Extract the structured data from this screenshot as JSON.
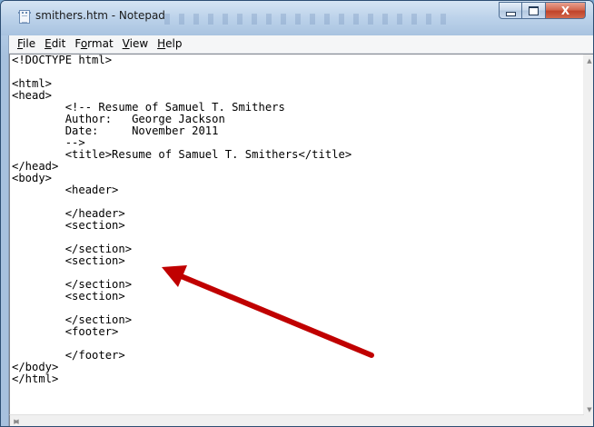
{
  "window": {
    "title": "smithers.htm - Notepad"
  },
  "caption": {
    "minimize_icon": "minimize-icon",
    "maximize_icon": "maximize-icon",
    "close_icon": "close-icon",
    "close_glyph": "X"
  },
  "menu": {
    "items": [
      {
        "label": "File",
        "accel": "F",
        "rest": "ile"
      },
      {
        "label": "Edit",
        "accel": "E",
        "rest": "dit"
      },
      {
        "label": "Format",
        "accel": "o",
        "pre": "F",
        "rest": "rmat"
      },
      {
        "label": "View",
        "accel": "V",
        "rest": "iew"
      },
      {
        "label": "Help",
        "accel": "H",
        "rest": "elp"
      }
    ]
  },
  "editor": {
    "lines": [
      "<!DOCTYPE html>",
      "",
      "<html>",
      "<head>",
      "        <!-- Resume of Samuel T. Smithers",
      "        Author:   George Jackson",
      "        Date:     November 2011",
      "        -->",
      "        <title>Resume of Samuel T. Smithers</title>",
      "</head>",
      "<body>",
      "        <header>",
      "",
      "        </header>",
      "        <section>",
      "",
      "        </section>",
      "        <section>",
      "",
      "        </section>",
      "        <section>",
      "",
      "        </section>",
      "        <footer>",
      "",
      "        </footer>",
      "</body>",
      "</html>"
    ]
  },
  "annotation": {
    "arrow_color": "#c00000"
  },
  "scrollbars": {
    "up_arrow": "▲",
    "down_arrow": "▼",
    "left_arrow": "◀",
    "right_arrow": "▶"
  }
}
